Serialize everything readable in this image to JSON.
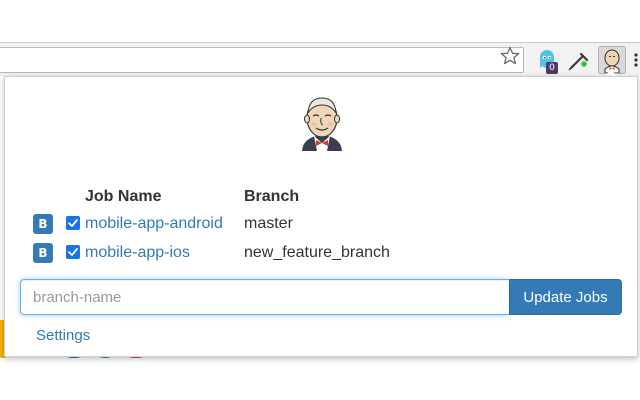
{
  "toolbar": {
    "extensions": [
      {
        "icon": "ghost-icon",
        "badge": "0"
      },
      {
        "icon": "eyedropper-icon"
      },
      {
        "icon": "jenkins-icon",
        "active": true
      },
      {
        "icon": "more-menu-icon"
      }
    ],
    "bookmark_icon": "star-icon"
  },
  "popup": {
    "logo_icon": "jenkins-mascot-icon",
    "table": {
      "headers": [
        "Job Name",
        "Branch"
      ],
      "rows": [
        {
          "build_label": "B",
          "checked": true,
          "job": "mobile-app-android",
          "branch": "master"
        },
        {
          "build_label": "B",
          "checked": true,
          "job": "mobile-app-ios",
          "branch": "new_feature_branch"
        }
      ]
    },
    "branch_input": {
      "placeholder": "branch-name",
      "value": ""
    },
    "update_button": "Update Jobs",
    "settings_link": "Settings"
  },
  "colors": {
    "primary": "#337ab7",
    "checkbox": "#1a73e8",
    "input_focus": "#66afe9",
    "text": "#333333"
  }
}
